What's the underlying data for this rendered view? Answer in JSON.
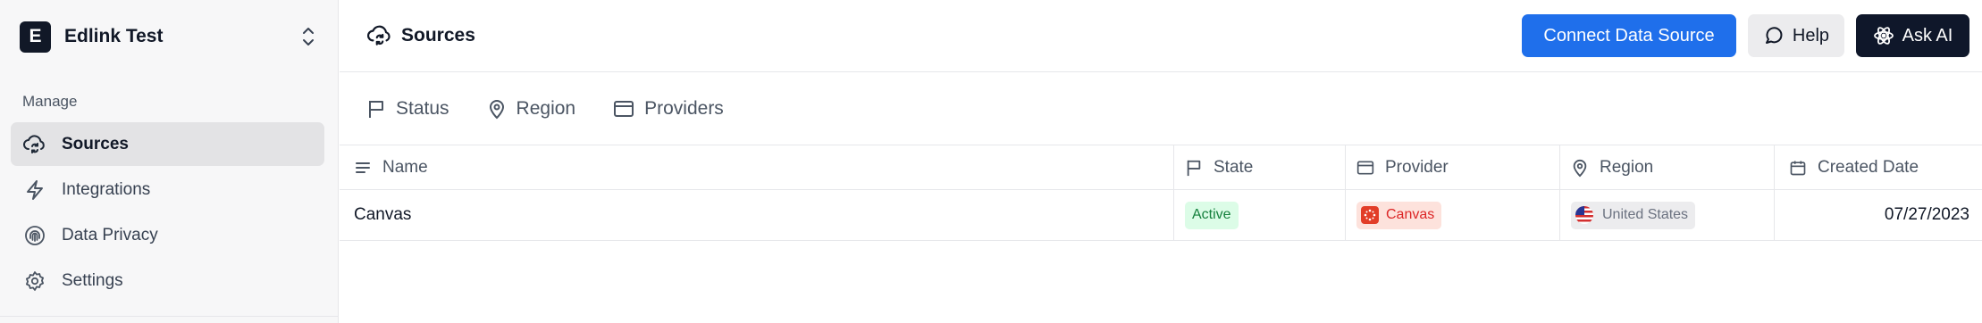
{
  "workspace": {
    "initial": "E",
    "name": "Edlink Test"
  },
  "sidebar": {
    "section_label": "Manage",
    "items": [
      {
        "label": "Sources",
        "icon": "cloud-sync-icon",
        "active": true
      },
      {
        "label": "Integrations",
        "icon": "lightning-icon",
        "active": false
      },
      {
        "label": "Data Privacy",
        "icon": "fingerprint-icon",
        "active": false
      },
      {
        "label": "Settings",
        "icon": "gear-icon",
        "active": false
      }
    ]
  },
  "header": {
    "title": "Sources",
    "title_icon": "cloud-sync-icon",
    "connect_label": "Connect Data Source",
    "help_label": "Help",
    "ask_ai_label": "Ask AI"
  },
  "filters": [
    {
      "label": "Status",
      "icon": "flag-icon"
    },
    {
      "label": "Region",
      "icon": "location-pin-icon"
    },
    {
      "label": "Providers",
      "icon": "window-icon"
    }
  ],
  "table": {
    "columns": [
      {
        "label": "Name",
        "icon": "lines-icon"
      },
      {
        "label": "State",
        "icon": "flag-icon"
      },
      {
        "label": "Provider",
        "icon": "window-icon"
      },
      {
        "label": "Region",
        "icon": "location-pin-icon"
      },
      {
        "label": "Created Date",
        "icon": "calendar-icon"
      }
    ],
    "rows": [
      {
        "name": "Canvas",
        "state": "Active",
        "provider": "Canvas",
        "region": "United States",
        "created": "07/27/2023"
      }
    ]
  },
  "colors": {
    "primary": "#1f6feb",
    "dark_button": "#0f172a",
    "active_badge_bg": "#dcfce7",
    "active_badge_text": "#15803d",
    "provider_badge_bg": "#fde2dc",
    "provider_badge_text": "#dc2626"
  }
}
